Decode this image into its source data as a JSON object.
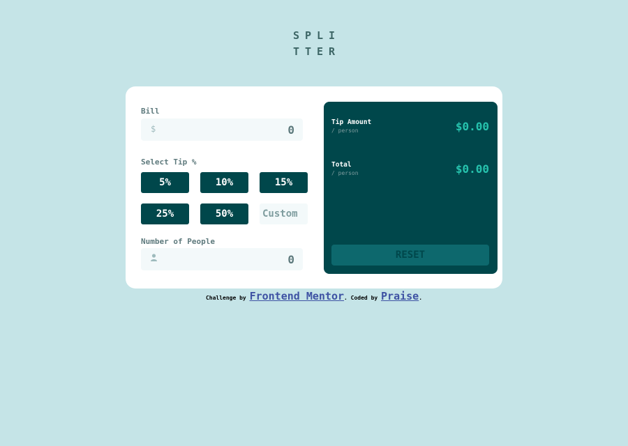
{
  "logo": {
    "line1": "SPLI",
    "line2": "TTER"
  },
  "form": {
    "bill_label": "Bill",
    "bill_icon": "dollar-icon",
    "bill_icon_glyph": "$",
    "bill_value": "0",
    "tip_label": "Select Tip %",
    "tips": [
      "5%",
      "10%",
      "15%",
      "25%",
      "50%"
    ],
    "custom_placeholder": "Custom",
    "people_label": "Number of People",
    "people_icon": "person-icon",
    "people_value": "0"
  },
  "results": {
    "tip_label": "Tip Amount",
    "tip_sub": "/ person",
    "tip_value": "$0.00",
    "total_label": "Total",
    "total_sub": "/ person",
    "total_value": "$0.00",
    "reset_label": "RESET"
  },
  "footer": {
    "challenge_prefix": "Challenge by",
    "challenge_link": "Frontend Mentor",
    "coded_prefix": ". Coded by",
    "coded_link": "Praise",
    "end": "."
  },
  "colors": {
    "background": "#c5e4e7",
    "dark_cyan": "#00474b",
    "strong_cyan": "#26c2ad",
    "card": "#ffffff"
  }
}
